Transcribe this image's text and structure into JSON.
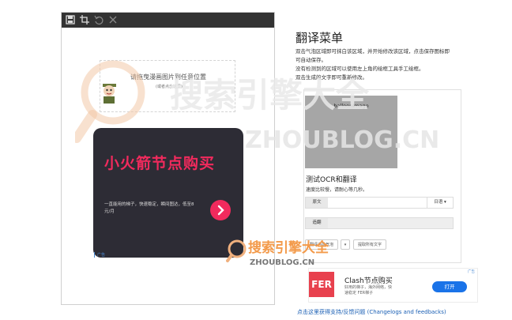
{
  "toolbar": {
    "icons": [
      "save-icon",
      "crop-icon",
      "undo-icon",
      "close-icon"
    ]
  },
  "dropzone": {
    "title": "请拖曳漫画图片到任意位置",
    "subtitle": "(或者点击这里)"
  },
  "ad_card": {
    "title": "小火箭节点购买",
    "description": "一直能用的梯子，快速稳定，瞬间图达，低至8元/月",
    "tag": "广告",
    "accent": "#f12a5d",
    "background": "#2d2c35"
  },
  "menu": {
    "title": "翻译菜单",
    "instructions": [
      "双击气泡区域即可抹白该区域，并开始修改该区域，点击保存图标即",
      "可自动保存。",
      "没有检测到的区域可以使用左上角的绘框工具手工绘框。",
      "双击生成的文字即可重新修改。"
    ]
  },
  "demo": {
    "balloon_label": "balloonImage",
    "ocr_title": "测试OCR和翻译",
    "ocr_subtitle": "速度比较慢，请耐心等几秒。",
    "original_label": "原文",
    "original_lang": "日语",
    "translation_label": "造翻",
    "translate_bubble_button": "翻译当前气泡",
    "extract_all_button": "提取所有文字"
  },
  "recommend_ad": {
    "logo_text": "FER",
    "title": "Clash节点购买",
    "description": "好用的梯子，海外网络，快速稳定 FER梯子",
    "open_button": "打开",
    "adchoice": "广告"
  },
  "footer": {
    "link": "点击这里获得支持/反馈问题 (Changelogs and feedbacks)"
  },
  "watermark": {
    "brand_cn": "搜索引擎大全",
    "brand_url": "ZHOUBLOG.CN"
  },
  "colors": {
    "toolbar": "#333333",
    "link": "#1a5fb4",
    "open_button": "#1a73e8",
    "fer_logo": "#e8414e"
  }
}
